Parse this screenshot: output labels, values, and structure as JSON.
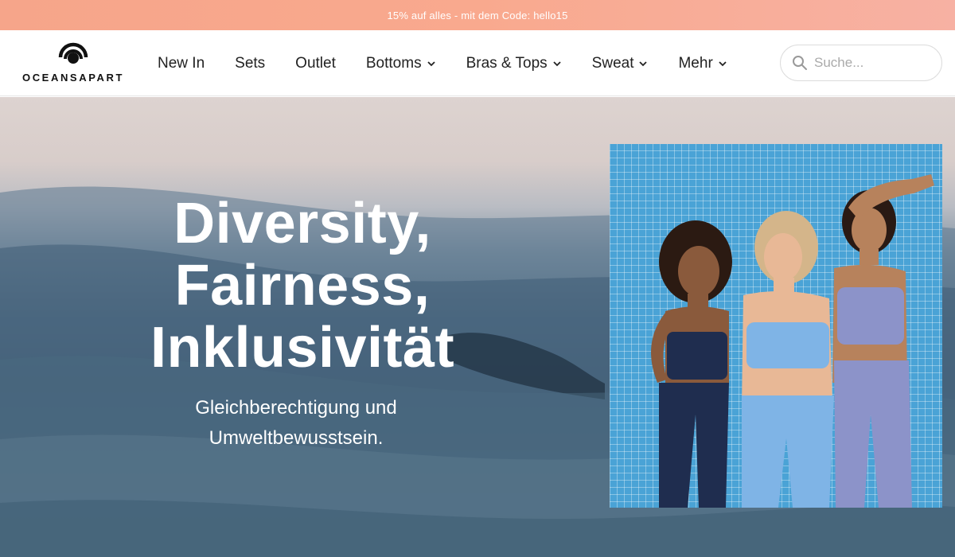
{
  "promo": {
    "text": "15% auf alles - mit dem Code: hello15"
  },
  "brand": {
    "name": "OCEANSAPART"
  },
  "nav": {
    "items": [
      {
        "label": "New In",
        "has_dropdown": false
      },
      {
        "label": "Sets",
        "has_dropdown": false
      },
      {
        "label": "Outlet",
        "has_dropdown": false
      },
      {
        "label": "Bottoms",
        "has_dropdown": true
      },
      {
        "label": "Bras & Tops",
        "has_dropdown": true
      },
      {
        "label": "Sweat",
        "has_dropdown": true
      },
      {
        "label": "Mehr",
        "has_dropdown": true
      }
    ]
  },
  "search": {
    "placeholder": "Suche...",
    "value": ""
  },
  "hero": {
    "title_lines": [
      "Diversity,",
      "Fairness,",
      "Inklusivität"
    ],
    "subtitle_lines": [
      "Gleichberechtigung und",
      "Umweltbewusstsein."
    ]
  },
  "colors": {
    "promo_bg": "#f6a58a",
    "tile_blue": "#4aa3d6",
    "navy_outfit": "#1f2d4f",
    "light_blue_outfit": "#7fb4e6",
    "lavender_outfit": "#8c93c9"
  },
  "icons": {
    "search": "search-icon",
    "dropdown": "chevron-down-icon",
    "logo": "oceansapart-logo-icon"
  }
}
